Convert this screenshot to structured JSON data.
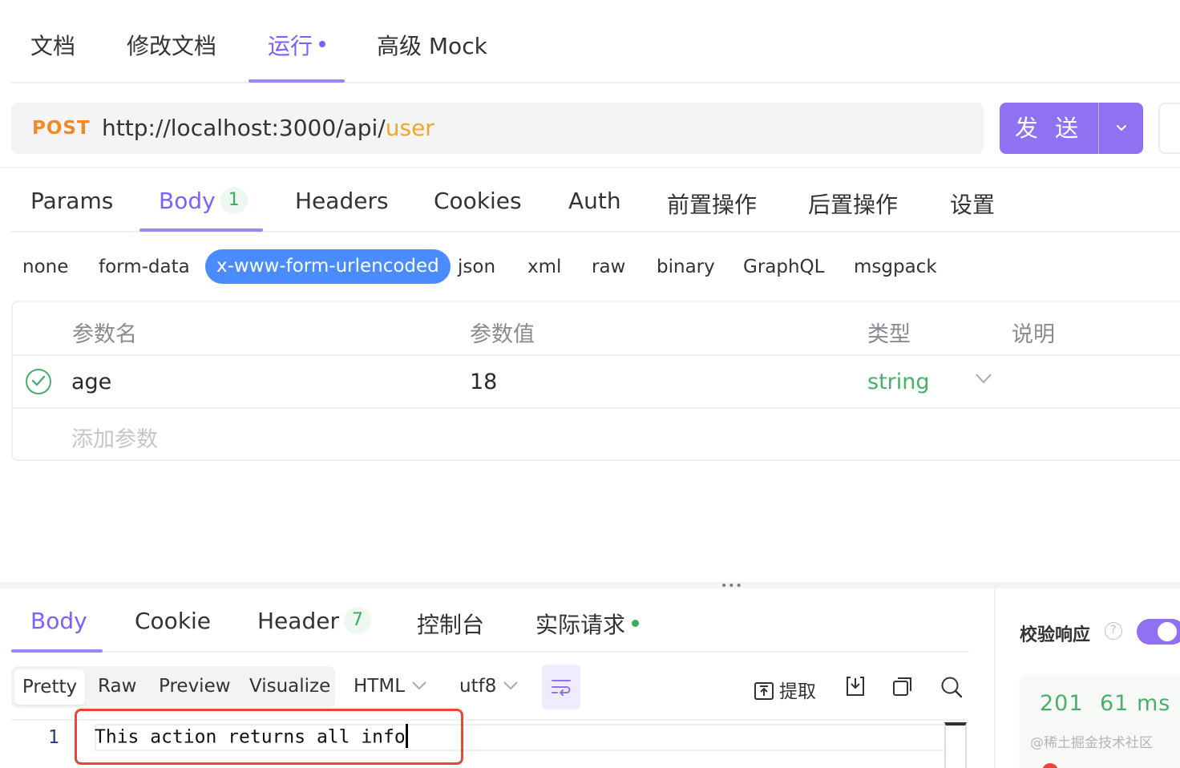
{
  "top_tabs": {
    "docs": "文档",
    "edit_docs": "修改文档",
    "run": "运行",
    "advanced_mock": "高级 Mock"
  },
  "request": {
    "method": "POST",
    "url_base": "http://localhost:3000/api/",
    "url_path": "user",
    "send_label": "发 送"
  },
  "request_tabs": {
    "params": "Params",
    "body": "Body",
    "body_count": "1",
    "headers": "Headers",
    "cookies": "Cookies",
    "auth": "Auth",
    "pre_ops": "前置操作",
    "post_ops": "后置操作",
    "settings": "设置"
  },
  "body_types": {
    "none": "none",
    "form_data": "form-data",
    "urlencoded": "x-www-form-urlencoded",
    "json": "json",
    "xml": "xml",
    "raw": "raw",
    "binary": "binary",
    "graphql": "GraphQL",
    "msgpack": "msgpack",
    "selected": "x-www-form-urlencoded"
  },
  "params_table": {
    "headers": {
      "name": "参数名",
      "value": "参数值",
      "type": "类型",
      "desc": "说明"
    },
    "rows": [
      {
        "enabled": true,
        "name": "age",
        "value": "18",
        "type": "string",
        "desc": ""
      }
    ],
    "add_placeholder": "添加参数"
  },
  "response_tabs": {
    "body": "Body",
    "cookie": "Cookie",
    "header": "Header",
    "header_count": "7",
    "console": "控制台",
    "actual_request": "实际请求"
  },
  "view_modes": {
    "pretty": "Pretty",
    "raw": "Raw",
    "preview": "Preview",
    "visualize": "Visualize",
    "format": "HTML",
    "encoding": "utf8",
    "extract": "提取"
  },
  "editor": {
    "line_number": "1",
    "content": "This action returns all info"
  },
  "validate": {
    "label": "校验响应",
    "help": "?",
    "enabled": true
  },
  "status": {
    "code": "201",
    "time": "61 ms"
  },
  "watermark": "@稀土掘金技术社区",
  "colors": {
    "accent": "#7b61ff",
    "send_button": "#8e72f2",
    "method_post": "#f08a24",
    "url_highlight": "#f5a623",
    "success": "#48b06b",
    "selected_body_type": "#4a8cff",
    "highlight_box": "#e8453c"
  }
}
